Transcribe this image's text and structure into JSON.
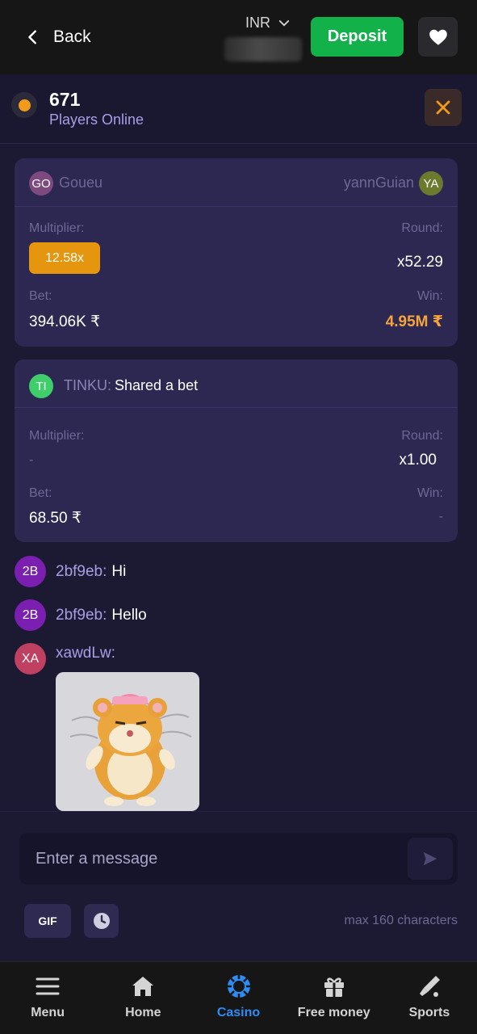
{
  "header": {
    "back_label": "Back",
    "currency": "INR",
    "deposit_label": "Deposit"
  },
  "online": {
    "count": "671",
    "label": "Players Online"
  },
  "bet_cards": [
    {
      "left_user": {
        "initials": "GO",
        "name": "Goueu",
        "color": "#7c4a7e"
      },
      "right_user": {
        "initials": "YA",
        "name": "yannGuian",
        "color": "#6c7a2e"
      },
      "multiplier_label": "Multiplier:",
      "multiplier": "12.58x",
      "round_label": "Round:",
      "round": "x52.29",
      "bet_label": "Bet:",
      "bet": "394.06K ₹",
      "win_label": "Win:",
      "win": "4.95M ₹"
    },
    {
      "user": {
        "initials": "TI",
        "name": "TINKU:",
        "color": "#3fcf6a"
      },
      "shared_text": "Shared a bet",
      "multiplier_label": "Multiplier:",
      "multiplier": "-",
      "round_label": "Round:",
      "round": "x1.00",
      "bet_label": "Bet:",
      "bet": "68.50 ₹",
      "win_label": "Win:",
      "win": "-"
    }
  ],
  "messages": [
    {
      "initials": "2B",
      "name": "2bf9eb:",
      "text": "Hi",
      "color": "#7a1fb0"
    },
    {
      "initials": "2B",
      "name": "2bf9eb:",
      "text": "Hello",
      "color": "#7a1fb0"
    },
    {
      "initials": "XA",
      "name": "xawdLw:",
      "text": "",
      "color": "#c04062"
    }
  ],
  "composer": {
    "placeholder": "Enter a message",
    "gif_label": "GIF",
    "max_chars": "max 160 characters"
  },
  "nav": [
    {
      "label": "Menu",
      "icon": "menu-icon"
    },
    {
      "label": "Home",
      "icon": "home-icon"
    },
    {
      "label": "Casino",
      "icon": "casino-icon",
      "active": true
    },
    {
      "label": "Free money",
      "icon": "gift-icon"
    },
    {
      "label": "Sports",
      "icon": "sports-icon"
    }
  ],
  "colors": {
    "deposit": "#12b14a",
    "accent_orange": "#e6950e",
    "win_orange": "#f7a43a",
    "active_nav": "#2d8df5"
  }
}
